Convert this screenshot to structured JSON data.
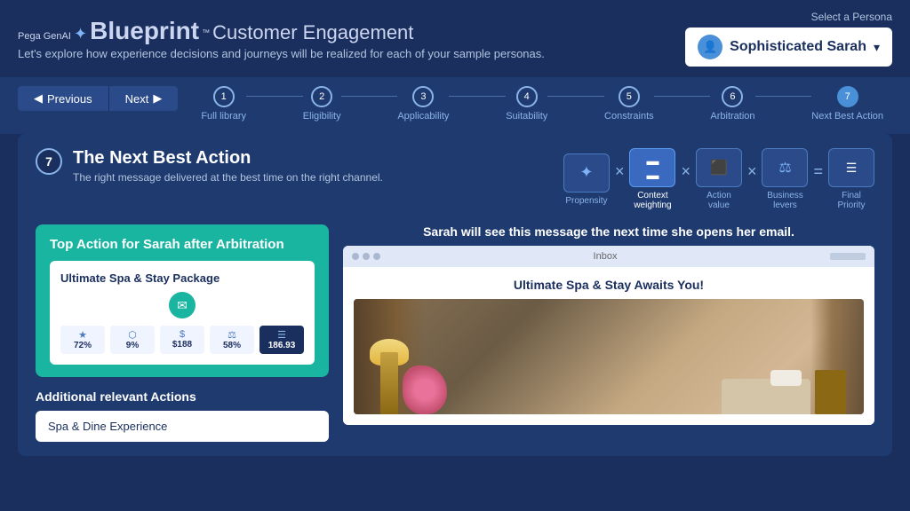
{
  "header": {
    "brand": "Pega GenAI Blueprint",
    "product": "Customer Engagement",
    "subtitle": "Let's explore how experience decisions and journeys will be realized for each of your sample personas.",
    "persona_label": "Select a Persona",
    "persona_name": "Sophisticated Sarah",
    "persona_dropdown_aria": "Select persona dropdown"
  },
  "navigation": {
    "prev_label": "Previous",
    "next_label": "Next",
    "steps": [
      {
        "number": "1",
        "label": "Full library",
        "active": false
      },
      {
        "number": "2",
        "label": "Eligibility",
        "active": false
      },
      {
        "number": "3",
        "label": "Applicability",
        "active": false
      },
      {
        "number": "4",
        "label": "Suitability",
        "active": false
      },
      {
        "number": "5",
        "label": "Constraints",
        "active": false
      },
      {
        "number": "6",
        "label": "Arbitration",
        "active": false
      },
      {
        "number": "7",
        "label": "Next Best Action",
        "active": true
      }
    ]
  },
  "section": {
    "step_number": "7",
    "title": "The Next Best Action",
    "subtitle": "The right message delivered at the best time on the right channel."
  },
  "formula": {
    "icons": [
      {
        "id": "propensity",
        "symbol": "✦",
        "label": "Propensity",
        "highlighted": false
      },
      {
        "id": "context_weighting",
        "symbol": "▬",
        "label": "Context\nweighting",
        "highlighted": true
      },
      {
        "id": "action_value",
        "symbol": "⬛",
        "label": "Action\nvalue",
        "highlighted": false
      },
      {
        "id": "business_levers",
        "symbol": "⚖",
        "label": "Business\nlevers",
        "highlighted": false
      },
      {
        "id": "final_priority",
        "symbol": "☰",
        "label": "Final\nPriority",
        "highlighted": false
      }
    ],
    "operators": [
      "×",
      "×",
      "×",
      "="
    ]
  },
  "top_action": {
    "card_title": "Top Action for Sarah after Arbitration",
    "action_name": "Ultimate Spa & Stay Package",
    "metrics": [
      {
        "icon": "★",
        "value": "72%",
        "highlighted": false
      },
      {
        "icon": "⬡",
        "value": "9%",
        "highlighted": false
      },
      {
        "icon": "$",
        "value": "$188",
        "highlighted": false
      },
      {
        "icon": "⚖",
        "value": "58%",
        "highlighted": false
      },
      {
        "icon": "☰",
        "value": "186.93",
        "highlighted": true
      }
    ]
  },
  "additional_actions": {
    "title": "Additional relevant Actions",
    "items": [
      {
        "name": "Spa & Dine Experience"
      }
    ]
  },
  "email_preview": {
    "headline": "Sarah will see this message the next time she opens her email.",
    "inbox_label": "Inbox",
    "subject": "Ultimate Spa & Stay Awaits You!"
  }
}
